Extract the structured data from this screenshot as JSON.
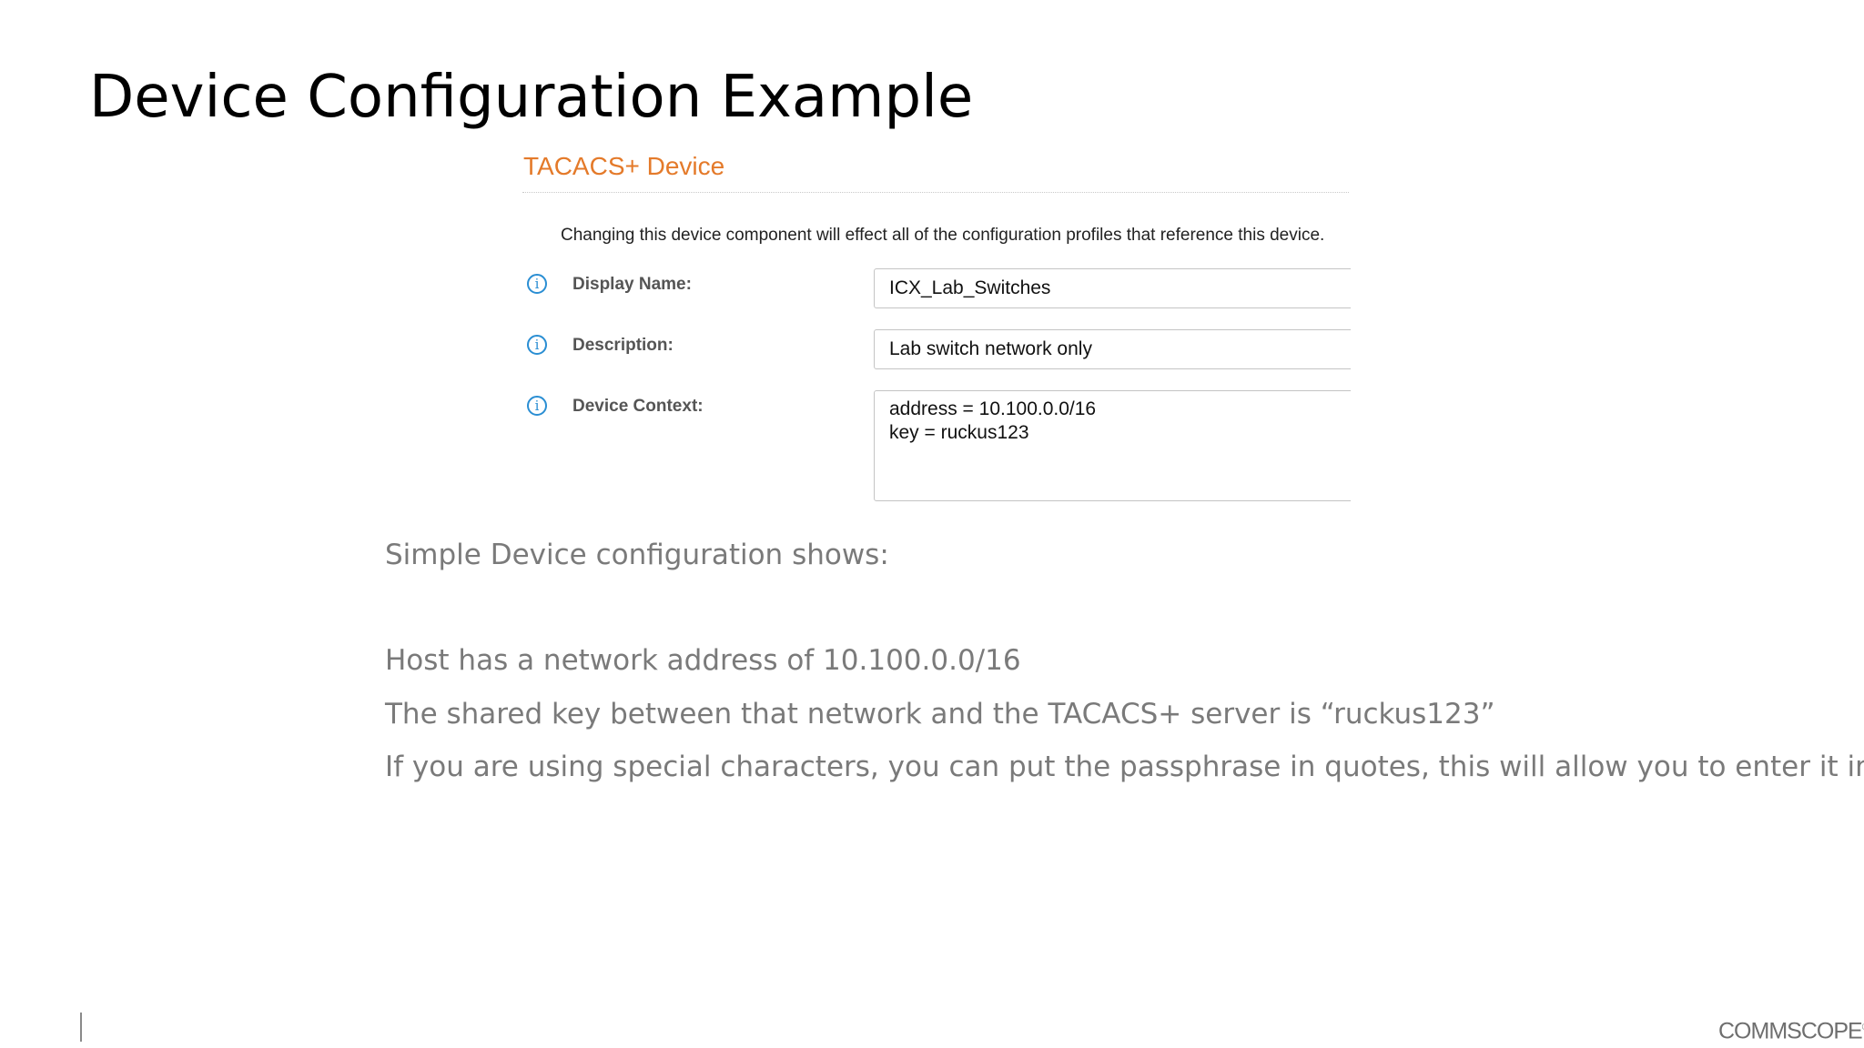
{
  "slide": {
    "title": "Device Configuration Example"
  },
  "form": {
    "title": "TACACS+ Device",
    "notice": "Changing this device component will effect all of the configuration profiles that reference this device.",
    "fields": [
      {
        "label": "Display Name:",
        "value": "ICX_Lab_Switches",
        "icon": "info-icon"
      },
      {
        "label": "Description:",
        "value": "Lab switch network only",
        "icon": "info-icon"
      },
      {
        "label": "Device Context:",
        "value": "address = 10.100.0.0/16\nkey = ruckus123",
        "icon": "info-icon"
      }
    ]
  },
  "body": {
    "intro": "Simple Device configuration shows:",
    "lines": [
      "Host has a network address of 10.100.0.0/16",
      "The shared key between that network and the TACACS+ server is “ruckus123”",
      "If you are using special characters, you can put the passphrase in quotes, this will allow you to enter it in."
    ]
  },
  "footer": {
    "logo_text": "COMMSCOPE",
    "logo_mark": "®"
  },
  "colors": {
    "form_title": "#e47a2a",
    "info_icon": "#2a8ed3",
    "body_text": "#7a7a7a"
  }
}
